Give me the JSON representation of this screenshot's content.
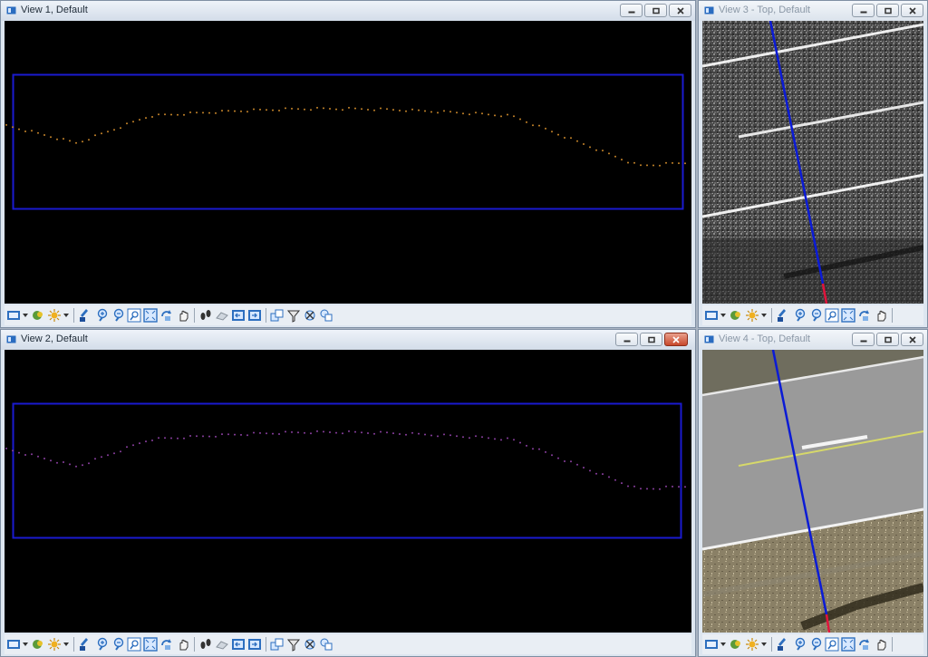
{
  "views": {
    "v1": {
      "title": "View 1, Default"
    },
    "v2": {
      "title": "View 2, Default"
    },
    "v3": {
      "title": "View 3 - Top, Default"
    },
    "v4": {
      "title": "View 4 - Top, Default"
    }
  },
  "colors": {
    "fence_blue": "#1a1ad0",
    "profile_orange": "#c8862a",
    "profile_purple": "#8a3fa0",
    "alignment_blue": "#0b1bd6",
    "alignment_end_red": "#e0143c",
    "stripe_yellow": "#d6d86a"
  },
  "icons": {
    "toolbar": [
      "view-attributes-icon",
      "dropdown-arrow-icon",
      "display-style-icon",
      "lighting-icon",
      "dropdown-arrow-icon",
      "update-view-icon",
      "zoom-in-icon",
      "zoom-out-icon",
      "window-area-icon",
      "fit-view-icon",
      "rotate-view-icon",
      "pan-view-icon",
      "walk-icon",
      "camera-icon",
      "previous-view-icon",
      "next-view-icon",
      "copy-view-icon",
      "clip-volume-icon",
      "clip-mask-icon",
      "view-display-icon"
    ]
  }
}
